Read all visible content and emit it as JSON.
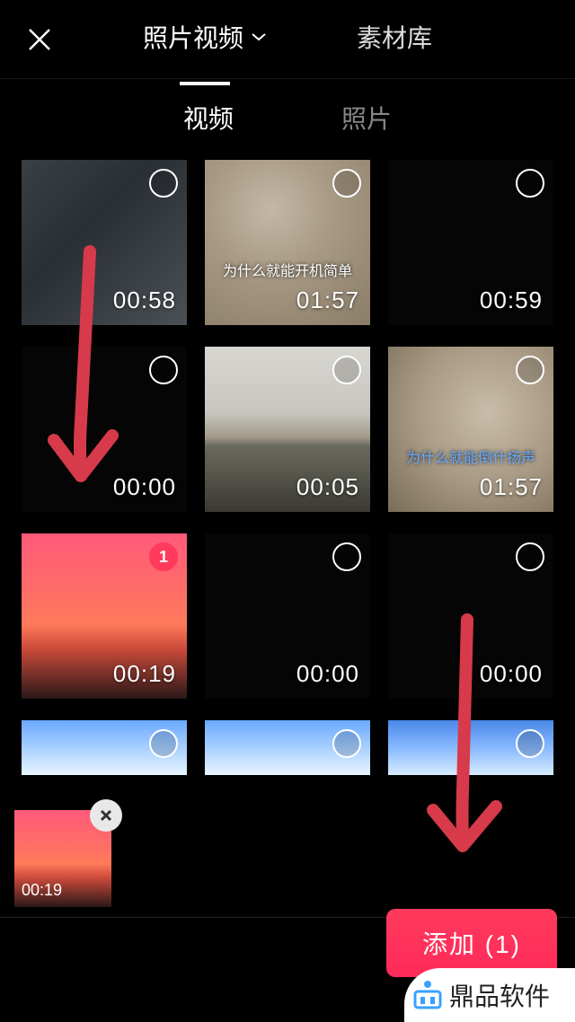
{
  "topbar": {
    "primary_tab": "照片视频",
    "secondary_tab": "素材库"
  },
  "subtabs": {
    "video": "视频",
    "photo": "照片"
  },
  "grid": {
    "items": [
      {
        "duration": "00:58",
        "selected": false,
        "bg": "bg-blur-gray",
        "overlay": ""
      },
      {
        "duration": "01:57",
        "selected": false,
        "bg": "bg-rock",
        "overlay": "为什么就能开机简单"
      },
      {
        "duration": "00:59",
        "selected": false,
        "bg": "bg-black",
        "overlay": ""
      },
      {
        "duration": "00:00",
        "selected": false,
        "bg": "bg-black",
        "overlay": ""
      },
      {
        "duration": "00:05",
        "selected": false,
        "bg": "bg-landscape",
        "overlay": ""
      },
      {
        "duration": "01:57",
        "selected": false,
        "bg": "bg-rock2",
        "overlay": "为什么就能倒什扬声"
      },
      {
        "duration": "00:19",
        "selected": true,
        "order": "1",
        "bg": "bg-sunset",
        "overlay": ""
      },
      {
        "duration": "00:00",
        "selected": false,
        "bg": "bg-black",
        "overlay": ""
      },
      {
        "duration": "00:00",
        "selected": false,
        "bg": "bg-black",
        "overlay": ""
      },
      {
        "duration": "",
        "selected": false,
        "bg": "bg-sky",
        "overlay": ""
      },
      {
        "duration": "",
        "selected": false,
        "bg": "bg-sky",
        "overlay": ""
      },
      {
        "duration": "",
        "selected": false,
        "bg": "bg-sky2",
        "overlay": ""
      }
    ]
  },
  "tray": {
    "items": [
      {
        "duration": "00:19",
        "bg": "bg-sunset"
      }
    ]
  },
  "add_button": {
    "label": "添加 (1)"
  },
  "watermark": {
    "label": "鼎品软件"
  }
}
